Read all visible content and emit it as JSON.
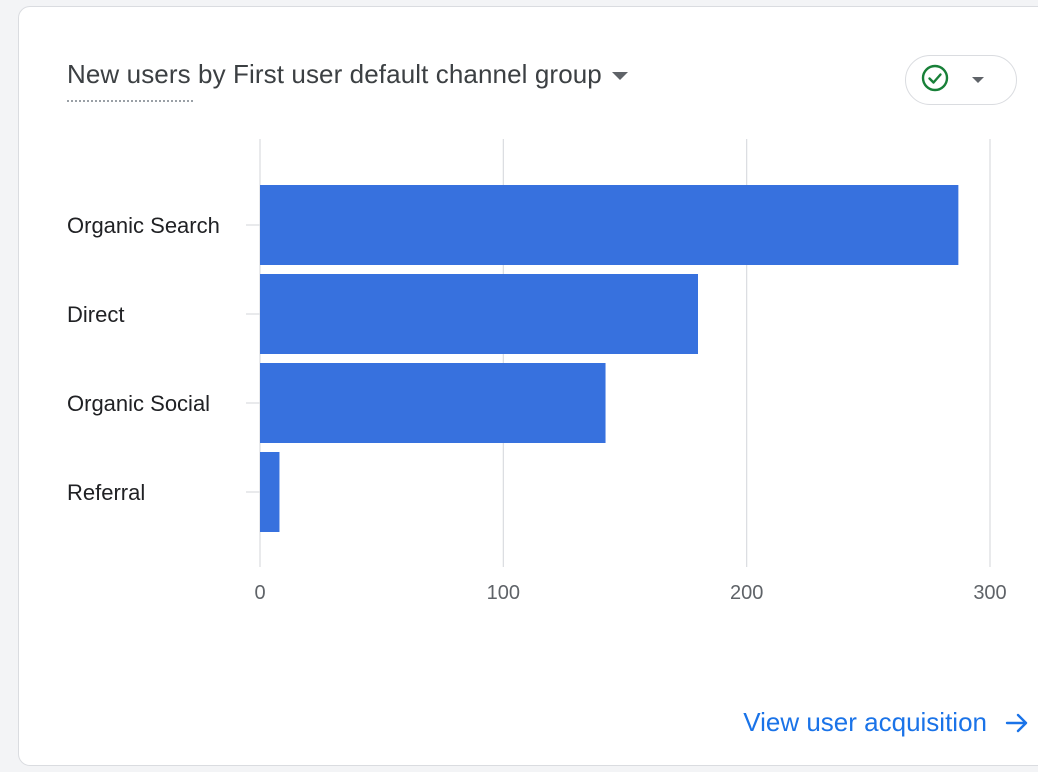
{
  "card": {
    "title": "New users by First user default channel group",
    "status_icon": "check-circle-icon",
    "footer_link": "View user acquisition",
    "footer_icon": "arrow-right-icon"
  },
  "colors": {
    "bar": "#3771de",
    "gridline": "#dadce0",
    "link": "#1a73e8",
    "status_check": "#188038"
  },
  "chart_data": {
    "type": "bar",
    "orientation": "horizontal",
    "title": "New users by First user default channel group",
    "xlabel": "",
    "ylabel": "",
    "categories": [
      "Organic Search",
      "Direct",
      "Organic Social",
      "Referral"
    ],
    "values": [
      287,
      180,
      142,
      8
    ],
    "xlim": [
      0,
      300
    ],
    "x_ticks": [
      "0",
      "100",
      "200",
      "300"
    ],
    "grid": true,
    "legend": "none"
  }
}
